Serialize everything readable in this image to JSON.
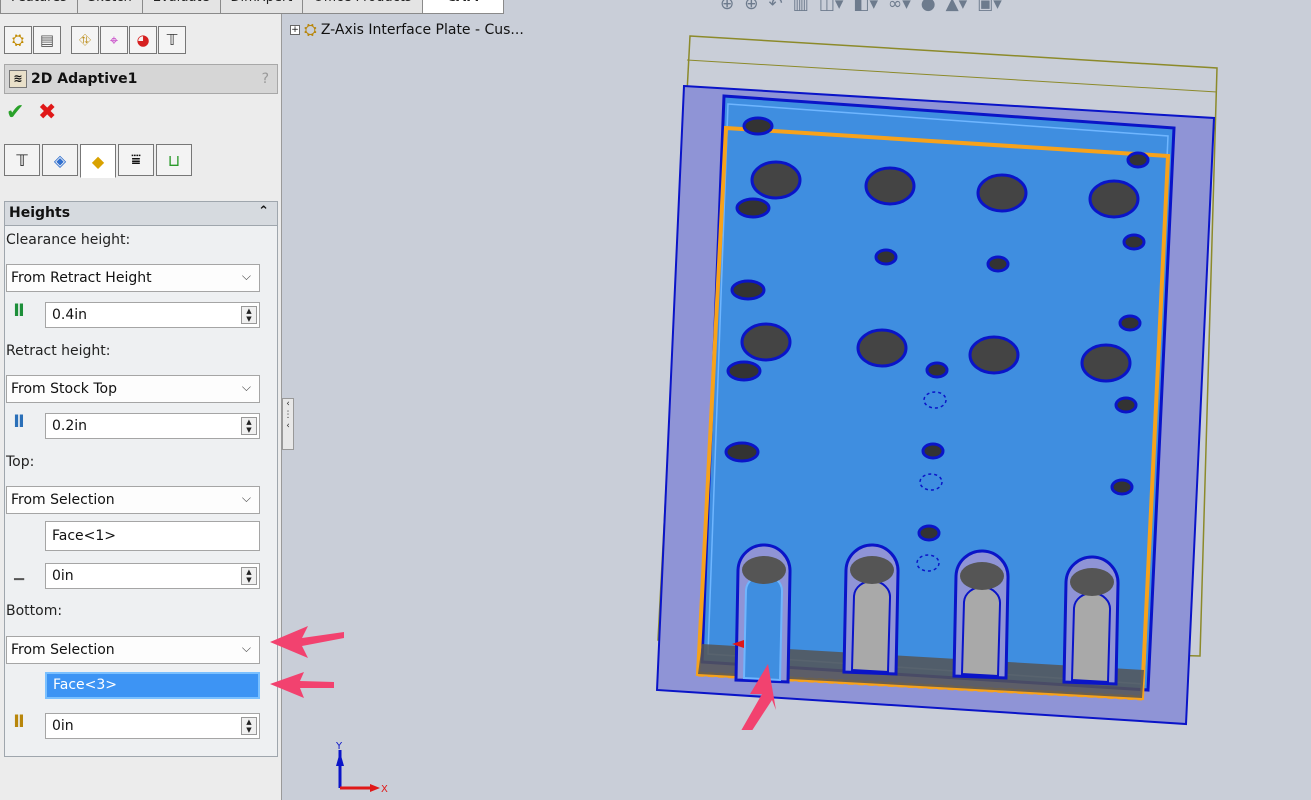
{
  "command_tabs": [
    "Features",
    "Sketch",
    "Evaluate",
    "DimXpert",
    "Office Products",
    "CAM"
  ],
  "feature": {
    "title": "2D Adaptive1",
    "help": "?"
  },
  "actions": {
    "ok_icon": "check-icon",
    "cancel_icon": "close-icon"
  },
  "heights": {
    "section_title": "Heights",
    "clearance": {
      "label": "Clearance height:",
      "mode": "From Retract Height",
      "offset": "0.4in"
    },
    "retract": {
      "label": "Retract height:",
      "mode": "From Stock Top",
      "offset": "0.2in"
    },
    "top": {
      "label": "Top:",
      "mode": "From Selection",
      "selection": "Face<1>",
      "offset": "0in"
    },
    "bottom": {
      "label": "Bottom:",
      "mode": "From Selection",
      "selection": "Face<3>",
      "offset": "0in"
    }
  },
  "tree": {
    "root_label": "Z-Axis Interface Plate - Cus..."
  },
  "viewport": {
    "triad_axis_x": "X",
    "triad_axis_y": "Y"
  },
  "colors": {
    "plate_face": "#3f8ee0",
    "plate_frame": "#8f94d6",
    "outline": "#0a14c8",
    "selection_orange": "#f7a21b",
    "annotation_arrow": "#f2426f"
  }
}
